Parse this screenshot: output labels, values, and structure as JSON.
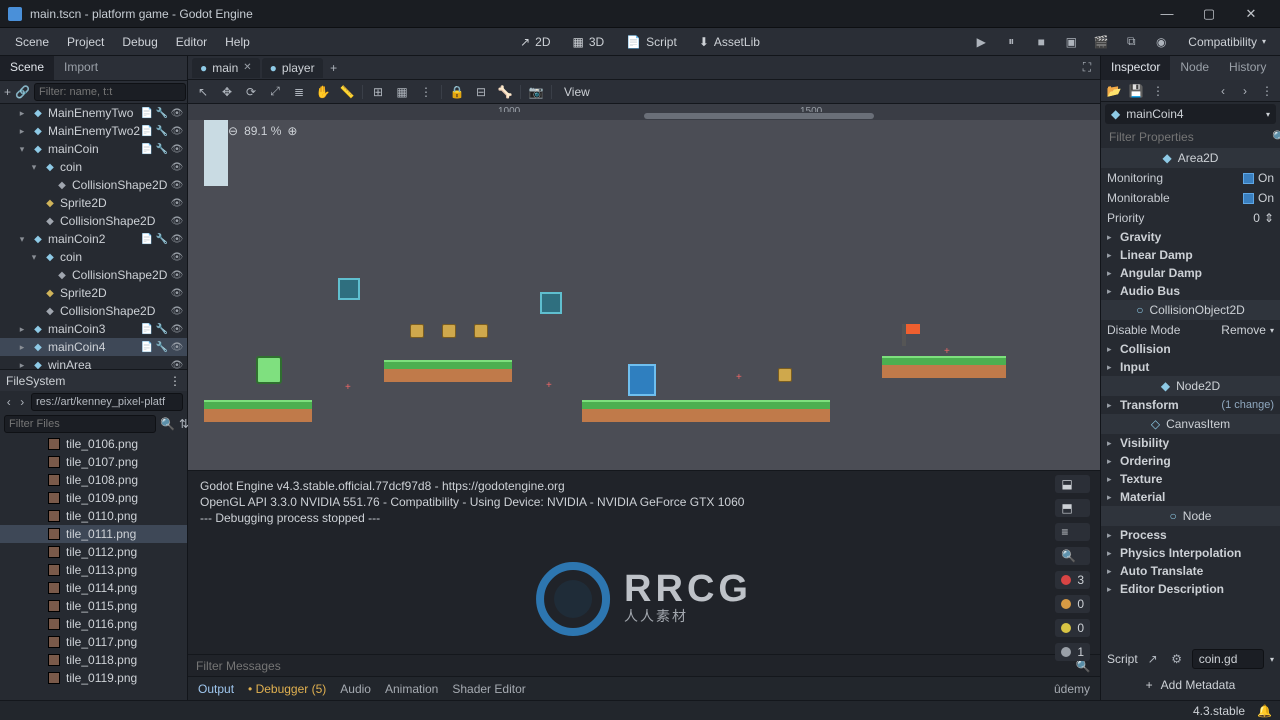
{
  "title": "main.tscn - platform game - Godot Engine",
  "menu": [
    "Scene",
    "Project",
    "Debug",
    "Editor",
    "Help"
  ],
  "workspaces": [
    {
      "label": "2D",
      "active": true
    },
    {
      "label": "3D",
      "active": false
    },
    {
      "label": "Script",
      "active": false
    },
    {
      "label": "AssetLib",
      "active": false
    }
  ],
  "renderer": "Compatibility",
  "left_panel": {
    "tabs": [
      "Scene",
      "Import"
    ],
    "active_tab": 0,
    "filter_placeholder": "Filter: name, t:t",
    "tree": [
      {
        "indent": 1,
        "icon": "#8ecae6",
        "label": "MainEnemyTwo",
        "marks": [
          "📄",
          "🔧",
          "👁"
        ]
      },
      {
        "indent": 1,
        "icon": "#8ecae6",
        "label": "MainEnemyTwo2",
        "marks": [
          "📄",
          "🔧",
          "👁"
        ]
      },
      {
        "indent": 1,
        "icon": "#8ecae6",
        "label": "mainCoin",
        "marks": [
          "📄",
          "🔧",
          "👁"
        ],
        "expanded": true
      },
      {
        "indent": 2,
        "icon": "#8ecae6",
        "label": "coin",
        "marks": [
          "👁"
        ],
        "expanded": true
      },
      {
        "indent": 3,
        "icon": "#a0a6af",
        "label": "CollisionShape2D",
        "marks": [
          "👁"
        ]
      },
      {
        "indent": 2,
        "icon": "#d0b45a",
        "label": "Sprite2D",
        "marks": [
          "👁"
        ]
      },
      {
        "indent": 2,
        "icon": "#a0a6af",
        "label": "CollisionShape2D",
        "marks": [
          "👁"
        ]
      },
      {
        "indent": 1,
        "icon": "#8ecae6",
        "label": "mainCoin2",
        "marks": [
          "📄",
          "🔧",
          "👁"
        ],
        "expanded": true
      },
      {
        "indent": 2,
        "icon": "#8ecae6",
        "label": "coin",
        "marks": [
          "👁"
        ],
        "expanded": true
      },
      {
        "indent": 3,
        "icon": "#a0a6af",
        "label": "CollisionShape2D",
        "marks": [
          "👁"
        ]
      },
      {
        "indent": 2,
        "icon": "#d0b45a",
        "label": "Sprite2D",
        "marks": [
          "👁"
        ]
      },
      {
        "indent": 2,
        "icon": "#a0a6af",
        "label": "CollisionShape2D",
        "marks": [
          "👁"
        ]
      },
      {
        "indent": 1,
        "icon": "#8ecae6",
        "label": "mainCoin3",
        "marks": [
          "📄",
          "🔧",
          "👁"
        ]
      },
      {
        "indent": 1,
        "icon": "#8ecae6",
        "label": "mainCoin4",
        "marks": [
          "📄",
          "🔧",
          "👁"
        ],
        "selected": true
      },
      {
        "indent": 1,
        "icon": "#8ecae6",
        "label": "winArea",
        "marks": [
          "👁"
        ]
      }
    ]
  },
  "filesystem": {
    "header": "FileSystem",
    "path": "res://art/kenney_pixel-platf",
    "filter_placeholder": "Filter Files",
    "items": [
      {
        "label": "tile_0106.png"
      },
      {
        "label": "tile_0107.png"
      },
      {
        "label": "tile_0108.png"
      },
      {
        "label": "tile_0109.png"
      },
      {
        "label": "tile_0110.png"
      },
      {
        "label": "tile_0111.png",
        "selected": true
      },
      {
        "label": "tile_0112.png"
      },
      {
        "label": "tile_0113.png"
      },
      {
        "label": "tile_0114.png"
      },
      {
        "label": "tile_0115.png"
      },
      {
        "label": "tile_0116.png"
      },
      {
        "label": "tile_0117.png"
      },
      {
        "label": "tile_0118.png"
      },
      {
        "label": "tile_0119.png"
      }
    ]
  },
  "scene_tabs": [
    {
      "label": "main",
      "active": true,
      "closable": true
    },
    {
      "label": "player",
      "active": false,
      "closable": false
    }
  ],
  "canvas": {
    "zoom": "89.1 %",
    "view_label": "View"
  },
  "output": {
    "lines": [
      "Godot Engine v4.3.stable.official.77dcf97d8 - https://godotengine.org",
      "OpenGL API 3.3.0 NVIDIA 551.76 - Compatibility - Using Device: NVIDIA - NVIDIA GeForce GTX 1060",
      "",
      "--- Debugging process stopped ---"
    ],
    "filter_placeholder": "Filter Messages",
    "tabs": [
      "Output",
      "Debugger (5)",
      "Audio",
      "Animation",
      "Shader Editor"
    ],
    "counts": {
      "error": 3,
      "warning": 0,
      "info": 0,
      "msgs": 1
    }
  },
  "inspector": {
    "tabs": [
      "Inspector",
      "Node",
      "History"
    ],
    "active_tab": 0,
    "node": "mainCoin4",
    "filter_placeholder": "Filter Properties",
    "sections": [
      {
        "type": "header",
        "icon": "◆",
        "label": "Area2D"
      },
      {
        "type": "prop",
        "label": "Monitoring",
        "value": "On",
        "check": true
      },
      {
        "type": "prop",
        "label": "Monitorable",
        "value": "On",
        "check": true
      },
      {
        "type": "prop",
        "label": "Priority",
        "value": "0",
        "spin": true
      },
      {
        "type": "expand",
        "label": "Gravity"
      },
      {
        "type": "expand",
        "label": "Linear Damp"
      },
      {
        "type": "expand",
        "label": "Angular Damp"
      },
      {
        "type": "expand",
        "label": "Audio Bus"
      },
      {
        "type": "header",
        "icon": "○",
        "label": "CollisionObject2D"
      },
      {
        "type": "prop",
        "label": "Disable Mode",
        "value": "Remove",
        "drop": true
      },
      {
        "type": "expand",
        "label": "Collision"
      },
      {
        "type": "expand",
        "label": "Input"
      },
      {
        "type": "header",
        "icon": "◆",
        "label": "Node2D"
      },
      {
        "type": "expand",
        "label": "Transform",
        "changes": "(1 change)"
      },
      {
        "type": "header",
        "icon": "◇",
        "label": "CanvasItem"
      },
      {
        "type": "expand",
        "label": "Visibility"
      },
      {
        "type": "expand",
        "label": "Ordering"
      },
      {
        "type": "expand",
        "label": "Texture"
      },
      {
        "type": "expand",
        "label": "Material"
      },
      {
        "type": "header",
        "icon": "○",
        "label": "Node"
      },
      {
        "type": "expand",
        "label": "Process"
      },
      {
        "type": "expand",
        "label": "Physics Interpolation"
      },
      {
        "type": "expand",
        "label": "Auto Translate"
      },
      {
        "type": "expand",
        "label": "Editor Description"
      }
    ],
    "script_label": "Script",
    "script_value": "coin.gd",
    "add_metadata": "Add Metadata"
  },
  "statusbar": {
    "version": "4.3.stable"
  },
  "watermark": {
    "text": "RRCG",
    "sub": "人人素材"
  }
}
